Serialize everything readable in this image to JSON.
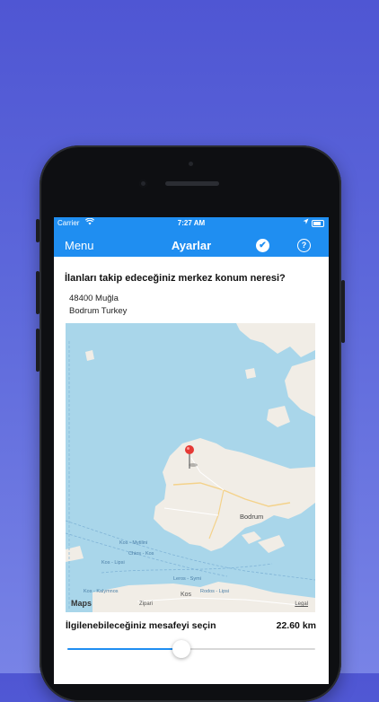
{
  "status_bar": {
    "carrier": "Carrier",
    "time": "7:27 AM"
  },
  "nav": {
    "menu_label": "Menu",
    "title": "Ayarlar",
    "confirm_icon": "checkmark-circle-icon",
    "help_icon": "question-circle-icon",
    "accent_color": "#1f8ef1"
  },
  "location": {
    "question": "İlanları takip edeceğiniz merkez konum neresi?",
    "address_line1": "48400 Muğla",
    "address_line2": "Bodrum Turkey"
  },
  "map": {
    "attribution": "Maps",
    "legal": "Legal",
    "labels": {
      "bodrum": "Bodrum",
      "kos_top": "Kos - Mytilini",
      "chios": "Chios - Kos",
      "lipsi": "Kos - Lipsi",
      "kalymnos": "Kos - Kalymnos",
      "leros": "Leros - Symi",
      "rodos": "Rodos - Lipsi",
      "kos": "Kos",
      "zipari": "Zipari"
    }
  },
  "distance": {
    "label": "İlgilenebileceğiniz mesafeyi seçin",
    "value_text": "22.60 km",
    "slider_fraction": 0.46
  }
}
